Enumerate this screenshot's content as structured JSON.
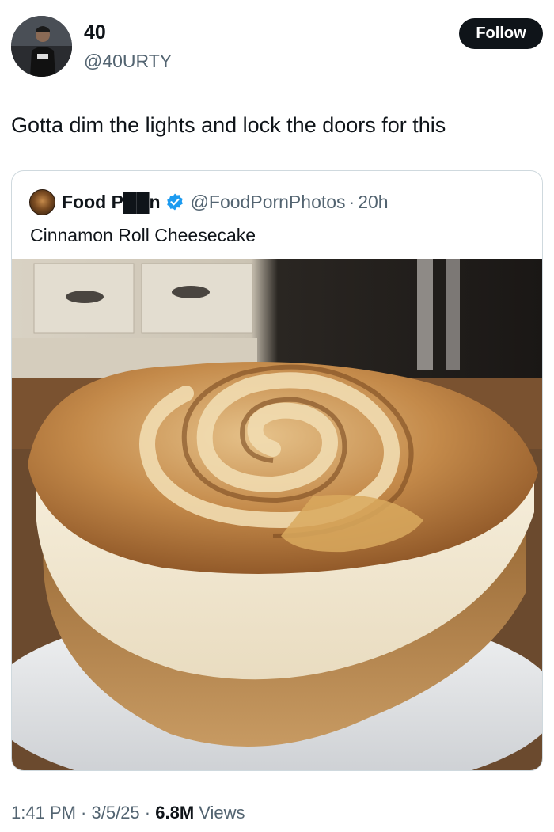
{
  "author": {
    "display_name": "40",
    "handle": "@40URTY",
    "avatar_icon": "profile-photo"
  },
  "follow_label": "Follow",
  "tweet_text": "Gotta dim the lights and lock the doors for this",
  "quote": {
    "display_name": "Food P██n",
    "handle": "@FoodPornPhotos",
    "separator": "·",
    "time": "20h",
    "text": "Cinnamon Roll Cheesecake",
    "verified_color": "#1d9bf0",
    "media_description_icon": "cheesecake-photo"
  },
  "meta": {
    "time": "1:41 PM",
    "sep1": " · ",
    "date": "3/5/25",
    "sep2": " · ",
    "views_count": "6.8M",
    "views_label": " Views"
  },
  "colors": {
    "text": "#0f1419",
    "secondary": "#536471",
    "border": "#cfd9de",
    "button_bg": "#0f1419"
  }
}
